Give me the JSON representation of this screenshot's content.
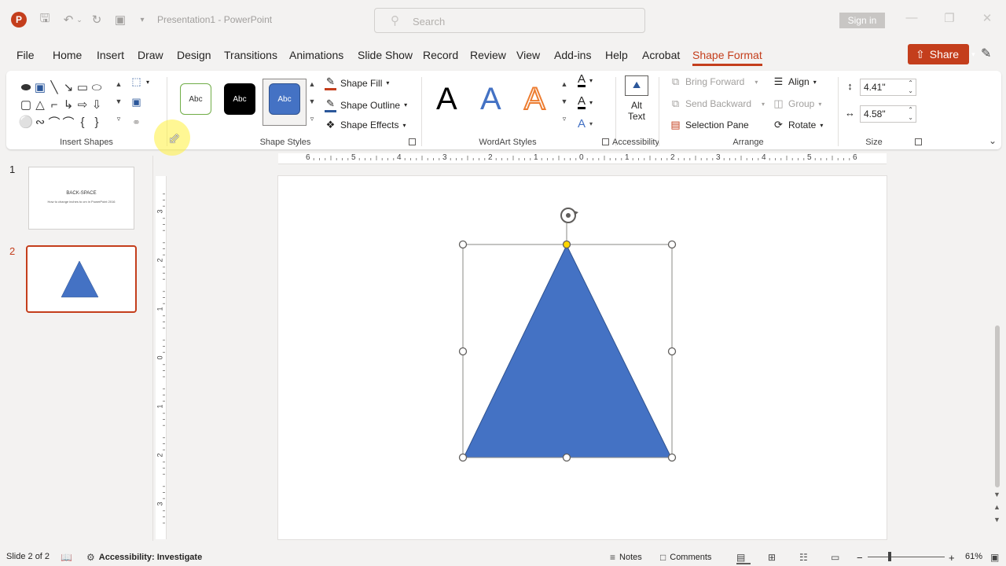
{
  "app": {
    "title": "Presentation1  -  PowerPoint",
    "logo_letter": "P",
    "search_placeholder": "Search",
    "sign_in": "Sign in"
  },
  "tabs": [
    {
      "label": "File",
      "active": false
    },
    {
      "label": "Home",
      "active": false
    },
    {
      "label": "Insert",
      "active": false
    },
    {
      "label": "Draw",
      "active": false
    },
    {
      "label": "Design",
      "active": false
    },
    {
      "label": "Transitions",
      "active": false
    },
    {
      "label": "Animations",
      "active": false
    },
    {
      "label": "Slide Show",
      "active": false
    },
    {
      "label": "Record",
      "active": false
    },
    {
      "label": "Review",
      "active": false
    },
    {
      "label": "View",
      "active": false
    },
    {
      "label": "Add-ins",
      "active": false
    },
    {
      "label": "Help",
      "active": false
    },
    {
      "label": "Acrobat",
      "active": false
    },
    {
      "label": "Shape Format",
      "active": true
    }
  ],
  "share_label": "Share",
  "ribbon": {
    "insert_shapes_label": "Insert Shapes",
    "shape_styles_label": "Shape Styles",
    "style_swatch_text": "Abc",
    "shape_fill": "Shape Fill",
    "shape_outline": "Shape Outline",
    "shape_effects": "Shape Effects",
    "wordart_label": "WordArt Styles",
    "wordart_letter": "A",
    "alt_text_line1": "Alt",
    "alt_text_line2": "Text",
    "accessibility_label": "Accessibility",
    "bring_forward": "Bring Forward",
    "send_backward": "Send Backward",
    "selection_pane": "Selection Pane",
    "align": "Align",
    "group": "Group",
    "rotate": "Rotate",
    "arrange_label": "Arrange",
    "height_value": "4.41\"",
    "width_value": "4.58\"",
    "size_label": "Size"
  },
  "slides": [
    {
      "number": "1",
      "title": "BACK-SPACE",
      "subtitle": "How to change inches to cm in PowerPoint 2016"
    },
    {
      "number": "2"
    }
  ],
  "ruler": {
    "horizontal": [
      "6",
      "5",
      "4",
      "3",
      "2",
      "1",
      "0",
      "1",
      "2",
      "3",
      "4",
      "5",
      "6"
    ],
    "vertical": [
      "3",
      "2",
      "1",
      "0",
      "1",
      "2",
      "3"
    ]
  },
  "colors": {
    "accent": "#c43e1c",
    "shape_fill": "#4472c4",
    "adjust_handle": "#ffd700"
  },
  "status": {
    "slide_count": "Slide 2 of 2",
    "accessibility": "Accessibility: Investigate",
    "notes": "Notes",
    "comments": "Comments",
    "zoom": "61%"
  }
}
